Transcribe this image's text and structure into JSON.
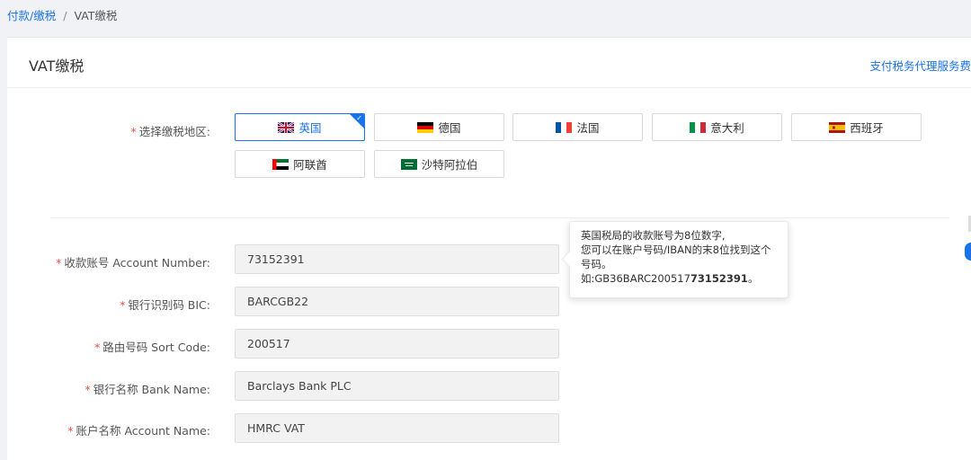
{
  "breadcrumb": {
    "parent": "付款/缴税",
    "separator": "/",
    "current": "VAT缴税"
  },
  "header": {
    "title": "VAT缴税",
    "link": "支付税务代理服务费"
  },
  "region": {
    "label": "选择缴税地区:",
    "required_mark": "*",
    "selected": "英国",
    "options": [
      {
        "label": "英国",
        "flag": "uk-flag"
      },
      {
        "label": "德国",
        "flag": "germany-flag"
      },
      {
        "label": "法国",
        "flag": "france-flag"
      },
      {
        "label": "意大利",
        "flag": "italy-flag"
      },
      {
        "label": "西班牙",
        "flag": "spain-flag"
      },
      {
        "label": "阿联酋",
        "flag": "uae-flag"
      },
      {
        "label": "沙特阿拉伯",
        "flag": "saudi-flag"
      }
    ]
  },
  "fields": [
    {
      "label": "收款账号 Account Number:",
      "value": "73152391"
    },
    {
      "label": "银行识别码 BIC:",
      "value": "BARCGB22"
    },
    {
      "label": "路由号码 Sort Code:",
      "value": "200517"
    },
    {
      "label": "银行名称 Bank Name:",
      "value": "Barclays Bank PLC"
    },
    {
      "label": "账户名称 Account Name:",
      "value": "HMRC VAT"
    }
  ],
  "tooltip": {
    "line1": "英国税局的收款账号为8位数字,",
    "line2": "您可以在账户号码/IBAN的末8位找到这个",
    "line3": "号码。",
    "line4_prefix": "如:GB36BARC200517",
    "line4_bold": "73152391",
    "line4_suffix": "。"
  },
  "colors": {
    "accent": "#1a73e8",
    "required": "#e54d42"
  }
}
